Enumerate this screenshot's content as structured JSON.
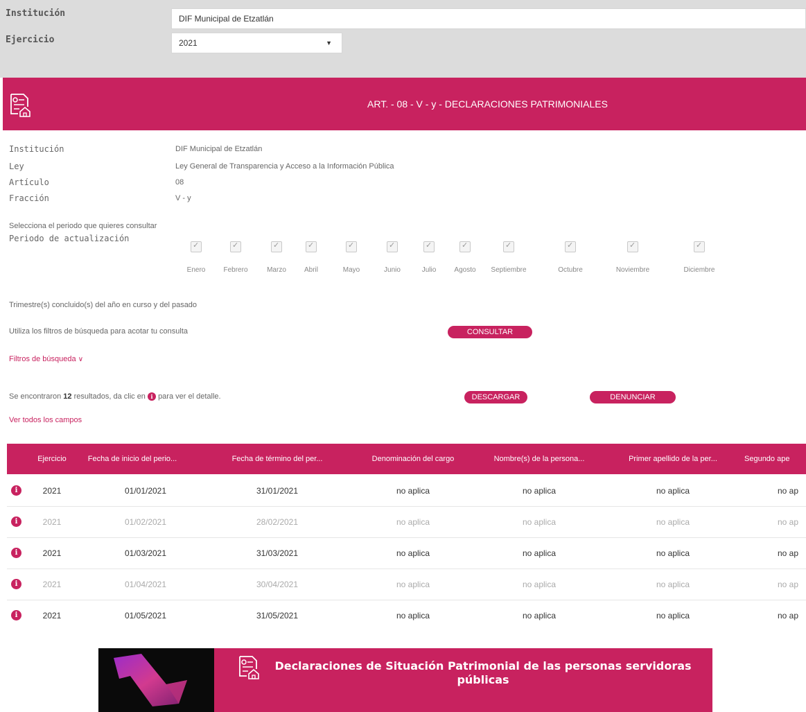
{
  "filters": {
    "institucion_label": "Institución",
    "institucion_value": "DIF Municipal de Etzatlán",
    "ejercicio_label": "Ejercicio",
    "ejercicio_value": "2021"
  },
  "banner": {
    "title": "ART. - 08 - V - y - DECLARACIONES PATRIMONIALES"
  },
  "meta": [
    {
      "label": "Institución",
      "value": "DIF Municipal de Etzatlán"
    },
    {
      "label": "Ley",
      "value": "Ley General de Transparencia y Acceso a la Información Pública"
    },
    {
      "label": "Artículo",
      "value": "08"
    },
    {
      "label": "Fracción",
      "value": "V - y"
    }
  ],
  "period": {
    "instruction": "Selecciona el periodo que quieres consultar",
    "label": "Periodo de actualización",
    "months": [
      "Enero",
      "Febrero",
      "Marzo",
      "Abril",
      "Mayo",
      "Junio",
      "Julio",
      "Agosto",
      "Septiembre",
      "Octubre",
      "Noviembre",
      "Diciembre"
    ]
  },
  "trimestre_text": "Trimestre(s) concluido(s) del año en curso y del pasado",
  "filters_hint": "Utiliza los filtros de búsqueda para acotar tu consulta",
  "consultar_label": "CONSULTAR",
  "filtros_link": "Filtros de búsqueda",
  "results": {
    "prefix": "Se encontraron",
    "count": "12",
    "suffix_a": "resultados, da clic en",
    "suffix_b": "para ver el detalle."
  },
  "descargar_label": "DESCARGAR",
  "denunciar_label": "DENUNCIAR",
  "ver_todos_link": "Ver todos los campos",
  "table": {
    "headers": [
      "Ejercicio",
      "Fecha de inicio del perio...",
      "Fecha de término del per...",
      "Denominación del cargo",
      "Nombre(s) de la persona...",
      "Primer apellido de la per...",
      "Segundo ape"
    ],
    "rows": [
      [
        "2021",
        "01/01/2021",
        "31/01/2021",
        "no aplica",
        "no aplica",
        "no aplica",
        "no ap"
      ],
      [
        "2021",
        "01/02/2021",
        "28/02/2021",
        "no aplica",
        "no aplica",
        "no aplica",
        "no ap"
      ],
      [
        "2021",
        "01/03/2021",
        "31/03/2021",
        "no aplica",
        "no aplica",
        "no aplica",
        "no ap"
      ],
      [
        "2021",
        "01/04/2021",
        "30/04/2021",
        "no aplica",
        "no aplica",
        "no aplica",
        "no ap"
      ],
      [
        "2021",
        "01/05/2021",
        "31/05/2021",
        "no aplica",
        "no aplica",
        "no aplica",
        "no ap"
      ]
    ]
  },
  "footer": {
    "title": "Declaraciones de Situación Patrimonial de las personas servidoras públicas"
  },
  "colors": {
    "accent": "#c8225f",
    "filter_bg": "#dcdcdc"
  },
  "icons": {
    "info": "info-icon",
    "document": "document-home-icon",
    "chevron": "chevron-down-icon"
  }
}
